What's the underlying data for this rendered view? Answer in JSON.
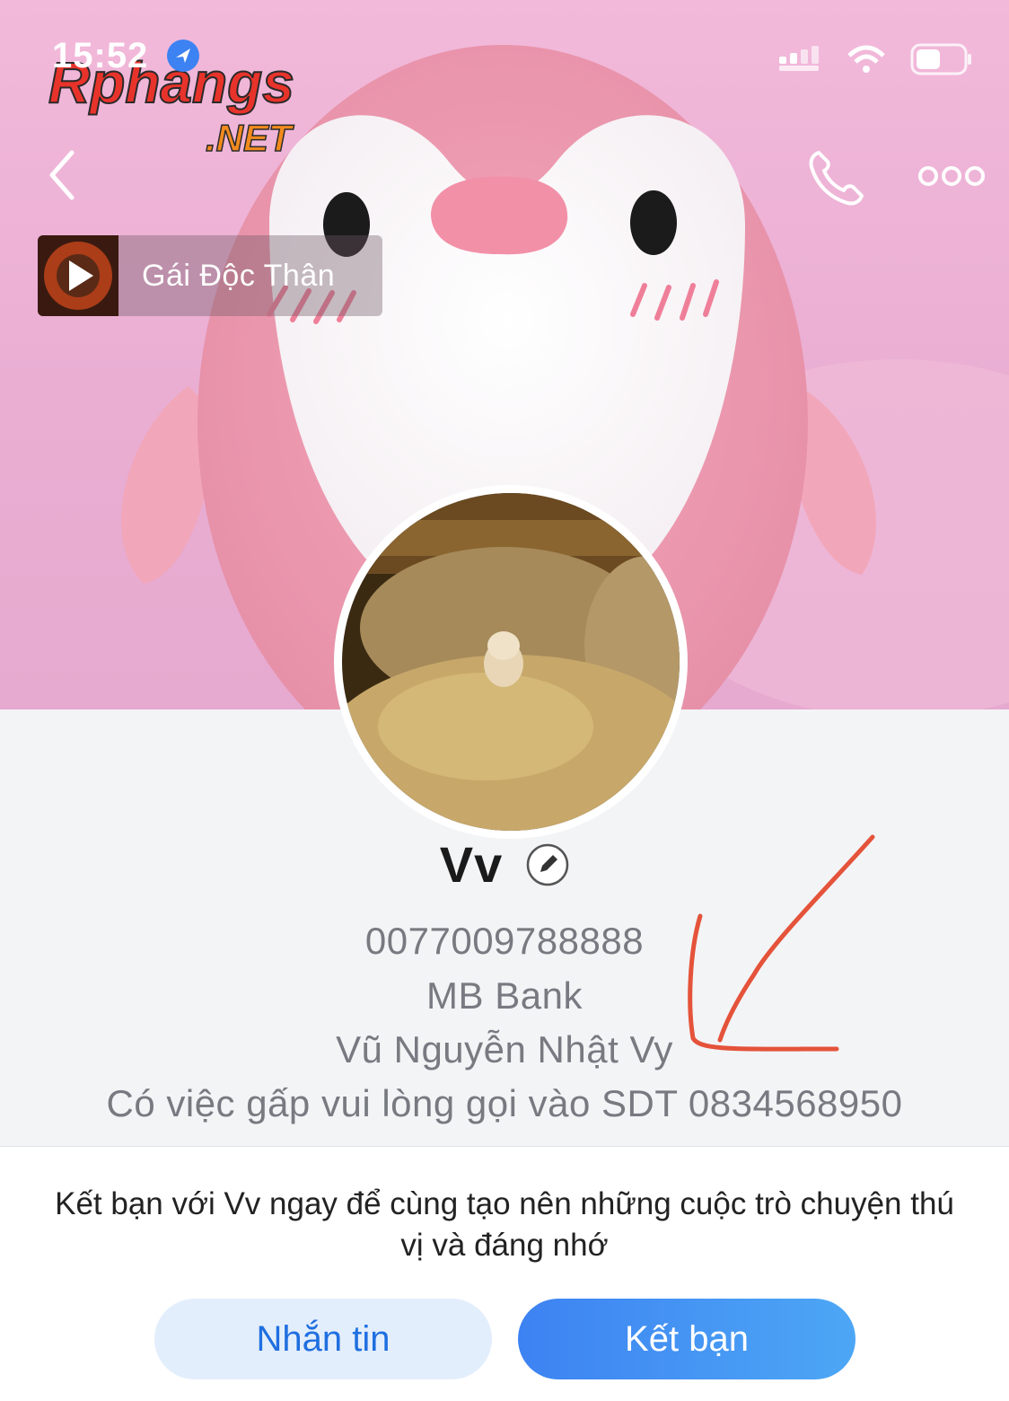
{
  "status_bar": {
    "time": "15:52"
  },
  "watermark": {
    "brand": "Rphangs",
    "suffix": ".NET"
  },
  "header": {
    "back_icon": "chevron-left-icon",
    "call_icon": "phone-icon",
    "more_icon": "more-dots-icon"
  },
  "music": {
    "title": "Gái Độc Thân",
    "icon": "play-icon"
  },
  "profile": {
    "name": "Vv",
    "bio_lines": [
      "0077009788888",
      "MB Bank",
      "Vũ Nguyễn Nhật Vy",
      "Có việc gấp vui lòng gọi vào SDT 0834568950"
    ]
  },
  "invite_text": "Kết bạn với Vv ngay để cùng tạo nên những cuộc trò chuyện thú vị và đáng nhớ",
  "actions": {
    "message_label": "Nhắn tin",
    "add_friend_label": "Kết bạn"
  },
  "colors": {
    "accent": "#3d82f2",
    "annotation": "#e4533a",
    "cover_pink": "#eaaed3"
  }
}
